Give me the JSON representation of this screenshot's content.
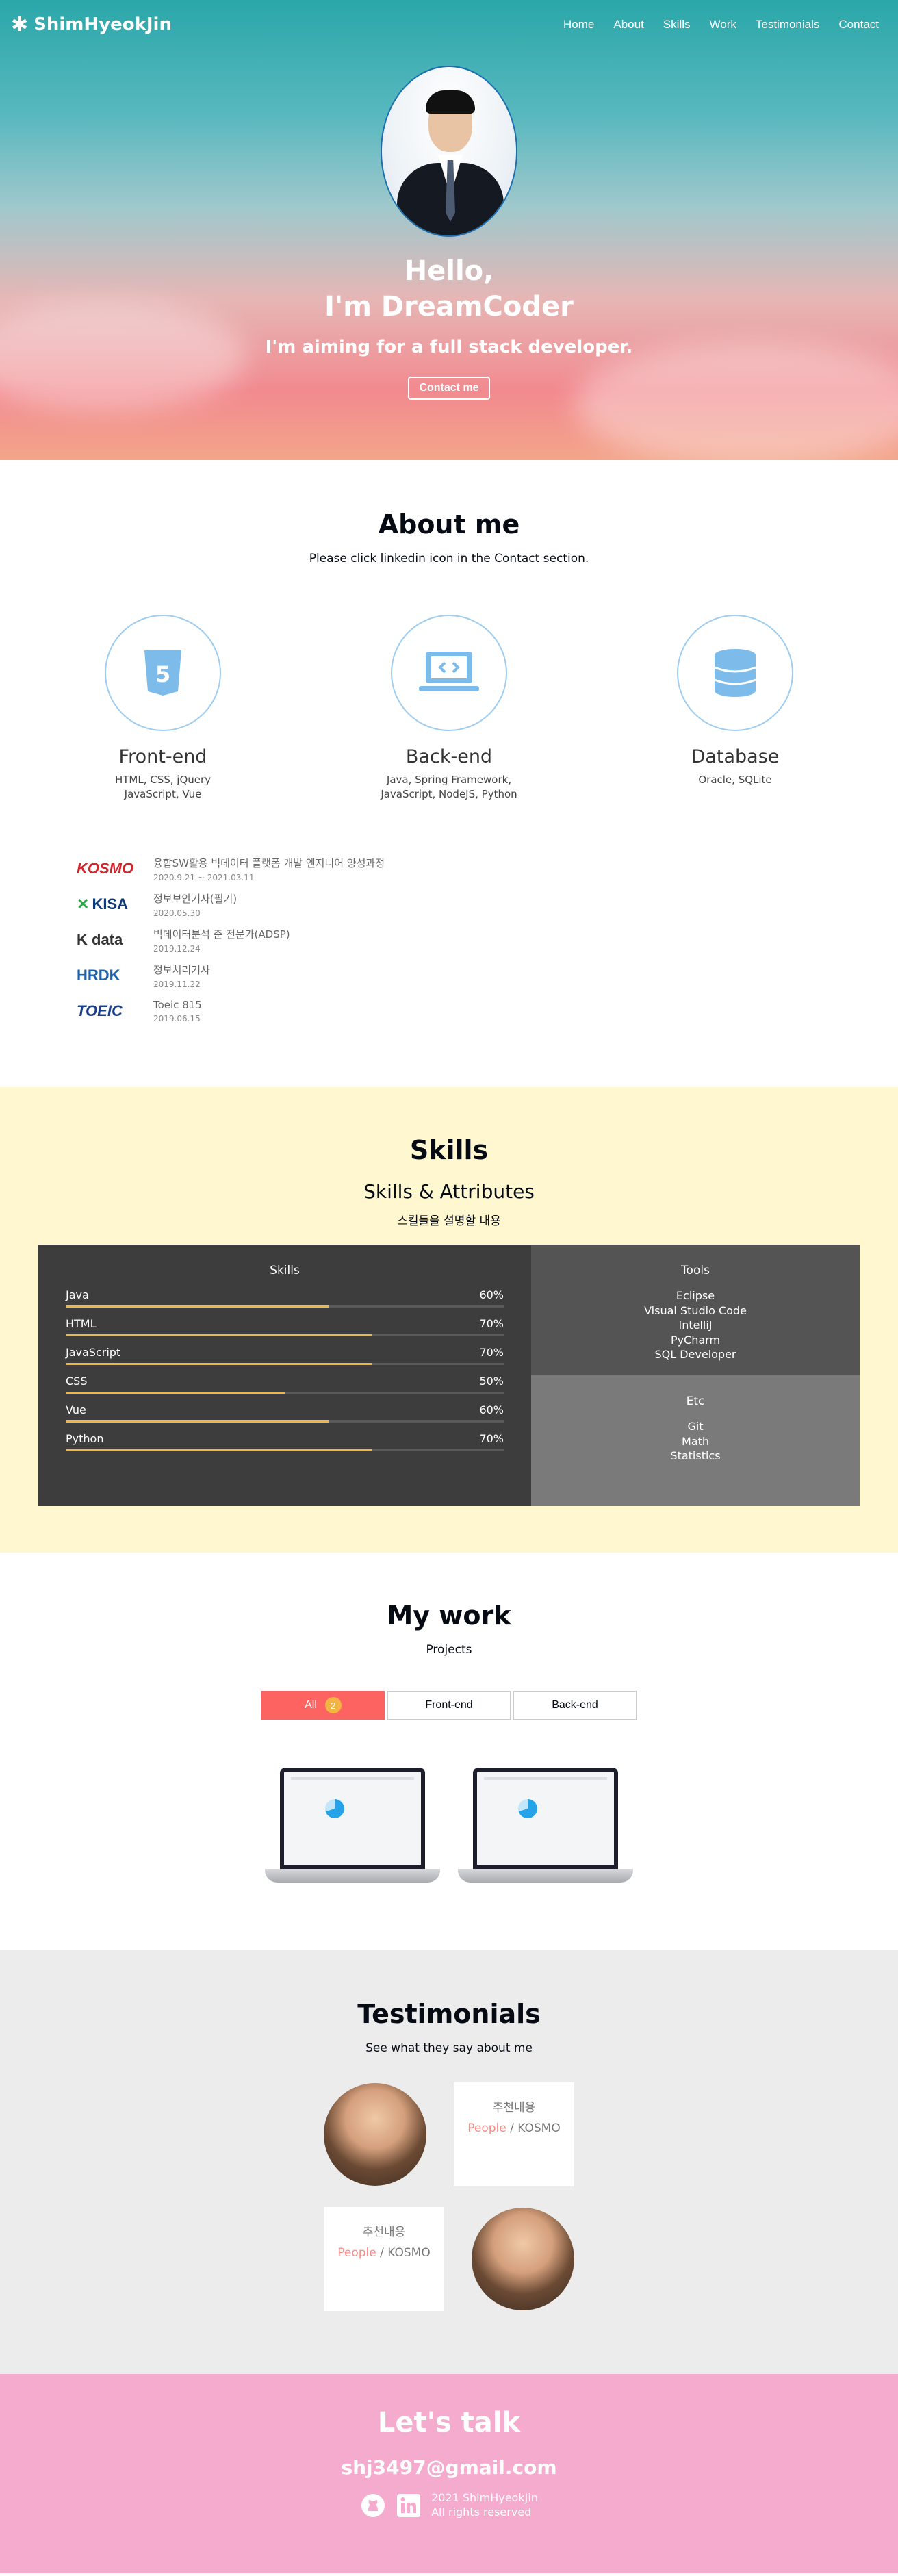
{
  "navbar": {
    "logo": "ShimHyeokJin",
    "items": [
      "Home",
      "About",
      "Skills",
      "Work",
      "Testimonials",
      "Contact"
    ]
  },
  "home": {
    "title_line1": "Hello,",
    "title_line2": "I'm DreamCoder",
    "description": "I'm aiming for a full stack developer.",
    "contact_button": "Contact me"
  },
  "about": {
    "title": "About me",
    "description": "Please click linkedin icon in the Contact section.",
    "majors": [
      {
        "icon": "html5-icon",
        "title": "Front-end",
        "desc_line1": "HTML, CSS, jQuery",
        "desc_line2": "JavaScript, Vue"
      },
      {
        "icon": "laptop-code-icon",
        "title": "Back-end",
        "desc_line1": "Java, Spring Framework,",
        "desc_line2": "JavaScript, NodeJS, Python"
      },
      {
        "icon": "database-icon",
        "title": "Database",
        "desc_line1": "Oracle, SQLite",
        "desc_line2": ""
      }
    ],
    "jobs": [
      {
        "logo": "KOSMO",
        "name": "융합SW활용 빅데이터 플랫폼 개발 엔지니어 양성과정",
        "period": "2020.9.21 ~ 2021.03.11"
      },
      {
        "logo": "KISA",
        "name": "정보보안기사(필기)",
        "period": "2020.05.30"
      },
      {
        "logo": "K data",
        "name": "빅데이터분석 준 전문가(ADSP)",
        "period": "2019.12.24"
      },
      {
        "logo": "HRDK",
        "name": "정보처리기사",
        "period": "2019.11.22"
      },
      {
        "logo": "TOEIC",
        "name": "Toeic 815",
        "period": "2019.06.15"
      }
    ]
  },
  "skills": {
    "title": "Skills",
    "subtitle": "Skills & Attributes",
    "description": "스킬들을 설명할 내용",
    "skills_title": "Skills",
    "list": [
      {
        "name": "Java",
        "value": "60%"
      },
      {
        "name": "HTML",
        "value": "70%"
      },
      {
        "name": "JavaScript",
        "value": "70%"
      },
      {
        "name": "CSS",
        "value": "50%"
      },
      {
        "name": "Vue",
        "value": "60%"
      },
      {
        "name": "Python",
        "value": "70%"
      }
    ],
    "tools_title": "Tools",
    "tools": [
      "Eclipse",
      "Visual Studio Code",
      "IntelliJ",
      "PyCharm",
      "SQL Developer"
    ],
    "etc_title": "Etc",
    "etc": [
      "Git",
      "Math",
      "Statistics"
    ]
  },
  "work": {
    "title": "My work",
    "description": "Projects",
    "categories": [
      {
        "label": "All",
        "count": "2"
      },
      {
        "label": "Front-end"
      },
      {
        "label": "Back-end"
      }
    ]
  },
  "testimonials": {
    "title": "Testimonials",
    "description": "See what they say about me",
    "items": [
      {
        "text": "추천내용",
        "people": "People",
        "org": " / KOSMO"
      },
      {
        "text": "추천내용",
        "people": "People",
        "org": " / KOSMO"
      }
    ]
  },
  "contact": {
    "title": "Let's talk",
    "email": "shj3497@gmail.com",
    "rights_line1": "2021 ShimHyeokJin",
    "rights_line2": "All rights reserved"
  },
  "colors": {
    "accent_orange": "#f2b543",
    "accent_red": "#fd6461",
    "skills_bg": "#fef7cf",
    "contact_bg": "#f4abcd",
    "icon_blue": "#7dbbea"
  }
}
